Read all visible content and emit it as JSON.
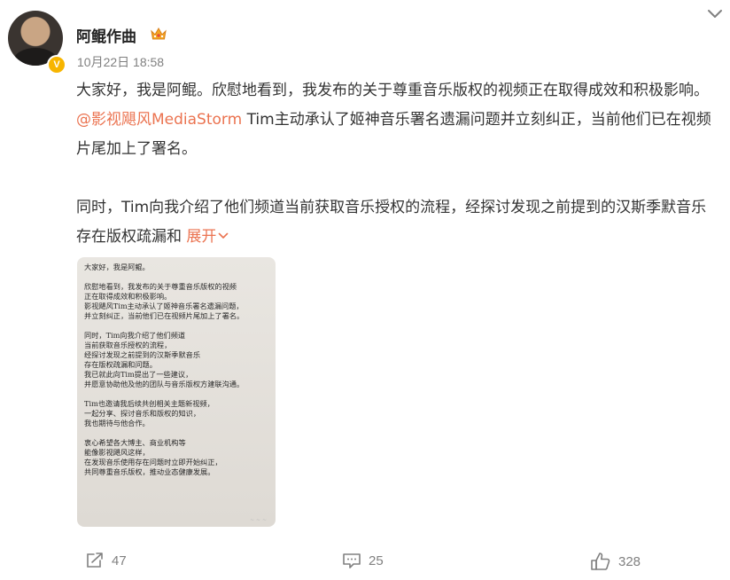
{
  "user": {
    "name": "阿鲲作曲",
    "verified_mark": "V",
    "timestamp": "10月22日 18:58"
  },
  "post": {
    "p1_before_link": "大家好，我是阿鲲。欣慰地看到，我发布的关于尊重音乐版权的视频正在取得成效和积极影响。",
    "mention": "@影视飓风MediaStorm",
    "p1_after_link": " Tim主动承认了姬神音乐署名遗漏问题并立刻纠正，当前他们已在视频片尾加上了署名。",
    "p2": "同时，Tim向我介绍了他们频道当前获取音乐授权的流程，经探讨发现之前提到的汉斯季默音乐存在版权疏漏和",
    "expand_label": "展开"
  },
  "image_text": "大家好，我是阿鲲。\n\n欣慰地看到，我发布的关于尊重音乐版权的视频\n正在取得成效和积极影响。\n影视飓风Tim主动承认了姬神音乐署名遗漏问题，\n并立刻纠正，当前他们已在视频片尾加上了署名。\n\n同时，Tim向我介绍了他们频道\n当前获取音乐授权的流程，\n经探讨发现之前提到的汉斯季默音乐\n存在版权疏漏和问题。\n我已就此向Tim提出了一些建议，\n并愿意协助他及他的团队与音乐版权方建联沟通。\n\nTim也邀请我后续共创相关主题新视频，\n一起分享、探讨音乐和版权的知识，\n我也期待与他合作。\n\n衷心希望各大博主、商业机构等\n能像影视飓风这样，\n在发现音乐使用存在问题时立即开始纠正，\n共同尊重音乐版权，推动业态健康发展。",
  "actions": {
    "repost_count": "47",
    "comment_count": "25",
    "like_count": "328"
  },
  "icons": {
    "crown": "crown-badge-icon",
    "chevron": "chevron-down-icon",
    "repost": "repost-icon",
    "comment": "comment-icon",
    "like": "thumb-up-icon"
  },
  "colors": {
    "link": "#eb7350",
    "muted": "#808080",
    "verified": "#f7b500"
  }
}
